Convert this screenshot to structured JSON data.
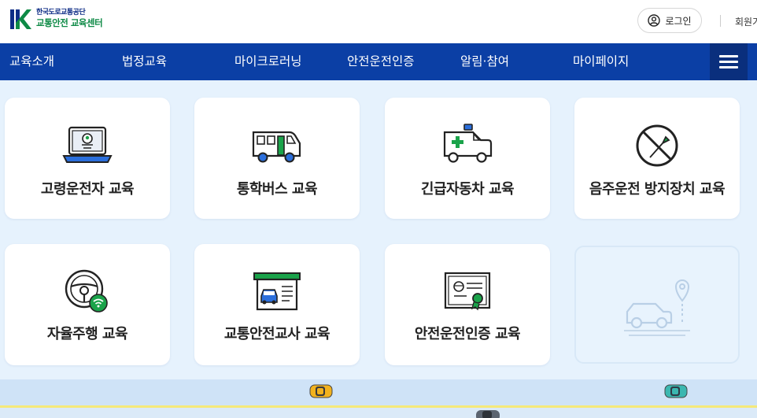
{
  "header": {
    "logo_line1": "한국도로교통공단",
    "logo_line2": "교통안전 교육센터",
    "login_label": "로그인",
    "join_label": "회원가입"
  },
  "nav": {
    "items": [
      "교육소개",
      "법정교육",
      "마이크로러닝",
      "안전운전인증",
      "알림·참여",
      "마이페이지"
    ]
  },
  "cards": [
    {
      "label": "고령운전자 교육",
      "icon": "laptop-driver-icon"
    },
    {
      "label": "통학버스 교육",
      "icon": "school-bus-icon"
    },
    {
      "label": "긴급자동차 교육",
      "icon": "ambulance-icon"
    },
    {
      "label": "음주운전 방지장치 교육",
      "icon": "no-drinking-icon"
    },
    {
      "label": "자율주행 교육",
      "icon": "steering-wheel-wifi-icon"
    },
    {
      "label": "교통안전교사 교육",
      "icon": "garage-car-icon"
    },
    {
      "label": "안전운전인증 교육",
      "icon": "certificate-icon"
    }
  ],
  "colors": {
    "nav_bg": "#0b3fa5",
    "page_bg": "#e6f2fd",
    "accent_green": "#1aa34a",
    "accent_blue": "#2b6fdc"
  }
}
